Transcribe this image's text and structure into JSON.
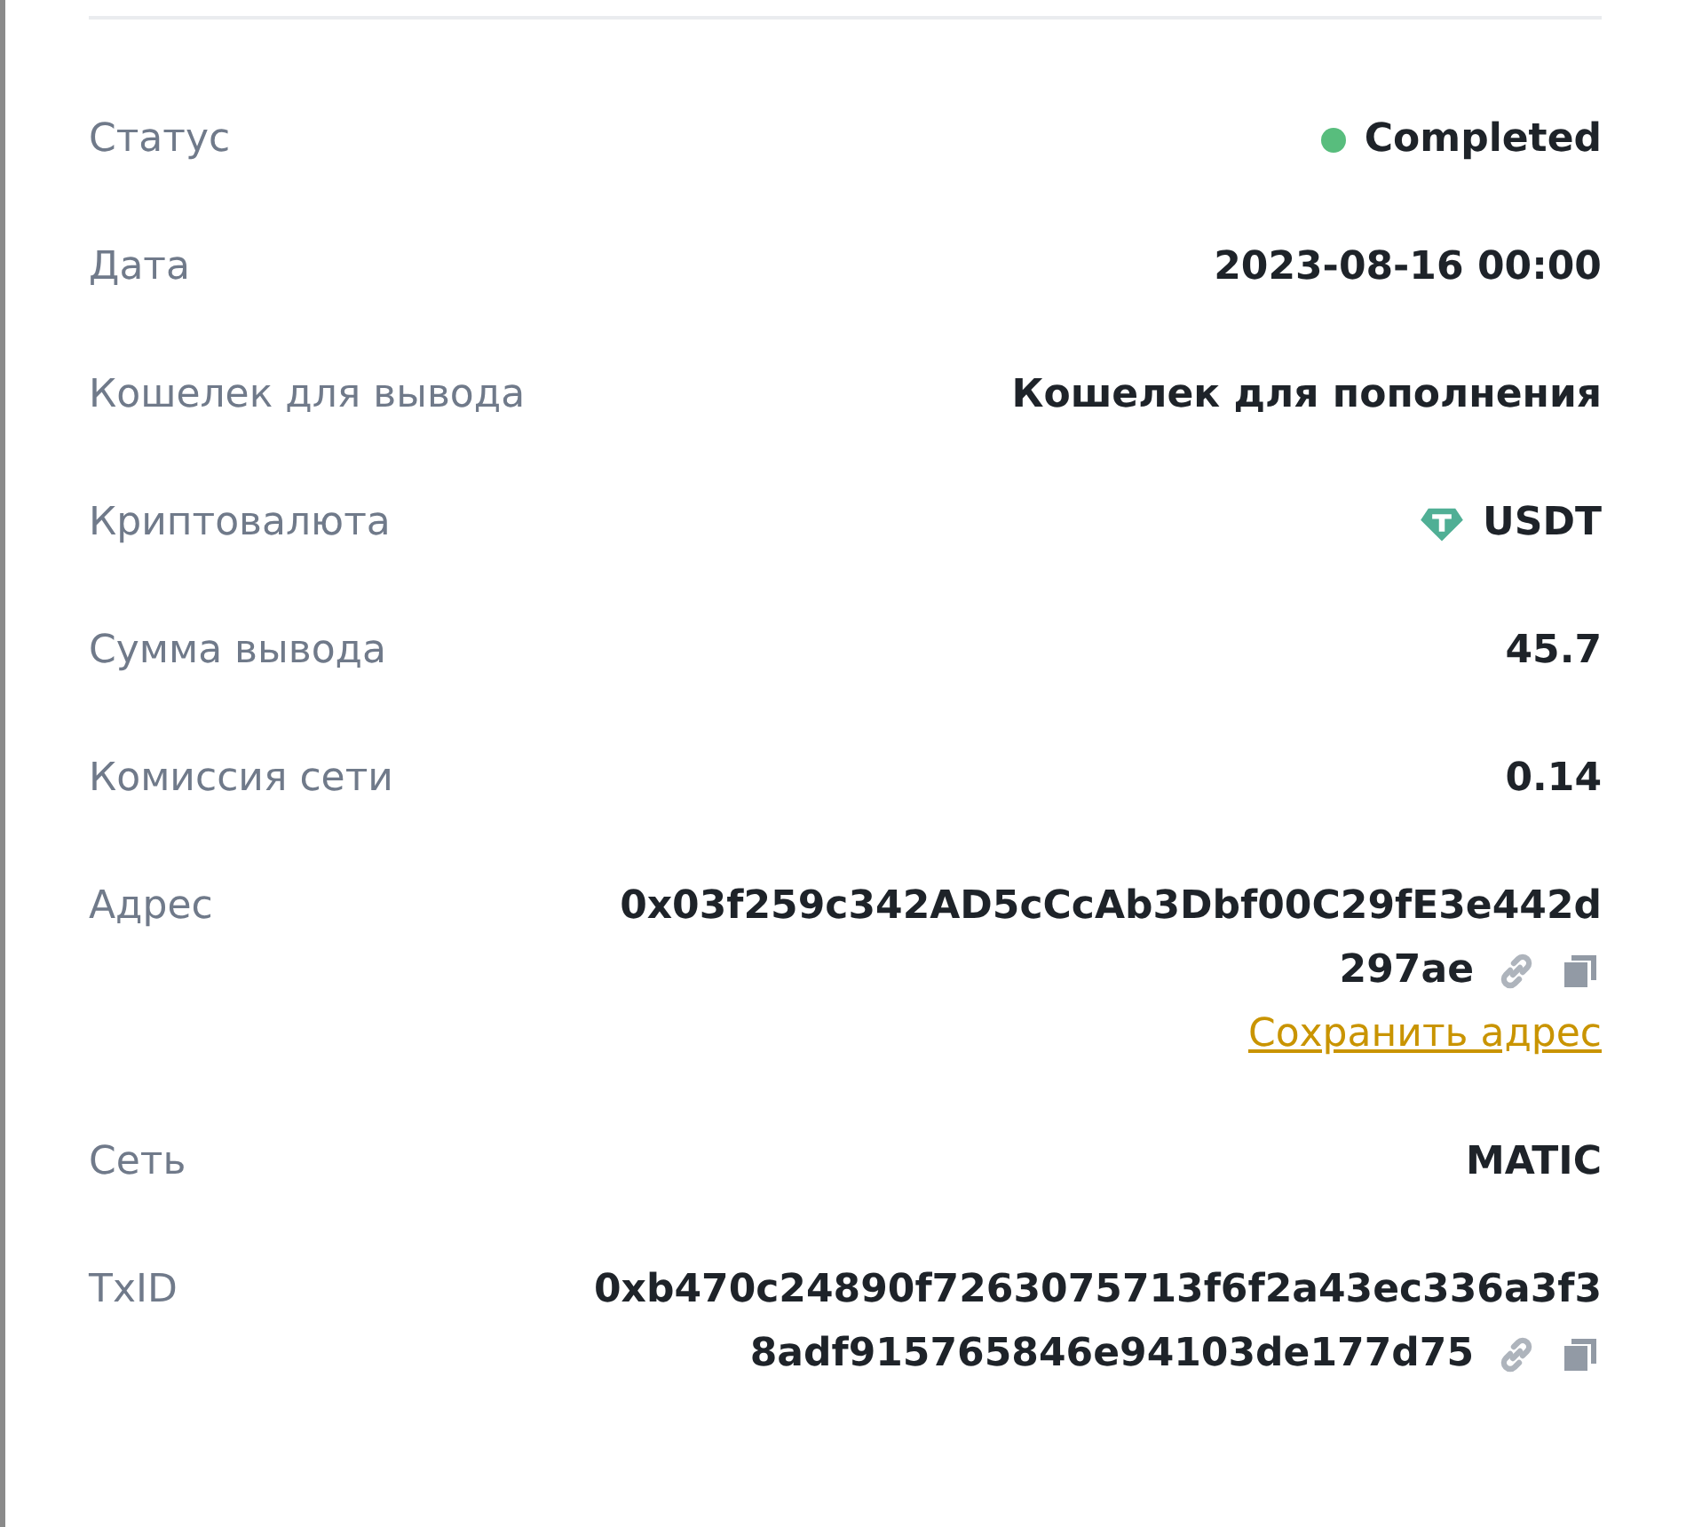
{
  "rows": [
    {
      "kind": "status",
      "label": "Статус",
      "value": "Completed",
      "color": "#58bd7d"
    },
    {
      "kind": "text",
      "label": "Дата",
      "value": "2023-08-16 00:00"
    },
    {
      "kind": "text",
      "label": "Кошелек для вывода",
      "value": "Кошелек для пополнения"
    },
    {
      "kind": "coin",
      "label": "Криптовалюта",
      "value": "USDT"
    },
    {
      "kind": "text",
      "label": "Сумма вывода",
      "value": "45.7"
    },
    {
      "kind": "text",
      "label": "Комиссия сети",
      "value": "0.14"
    },
    {
      "kind": "hash",
      "label": "Адрес",
      "lines": [
        "0x03f259c342AD5cCcAb3Dbf00C29fE3e442d",
        "297ae"
      ],
      "link": "Сохранить адрес"
    },
    {
      "kind": "text",
      "label": "Сеть",
      "value": "MATIC"
    },
    {
      "kind": "hash",
      "label": "TxID",
      "lines": [
        "0xb470c24890f7263075713f6f2a43ec336a3f3",
        "8adf915765846e94103de177d75"
      ]
    }
  ]
}
